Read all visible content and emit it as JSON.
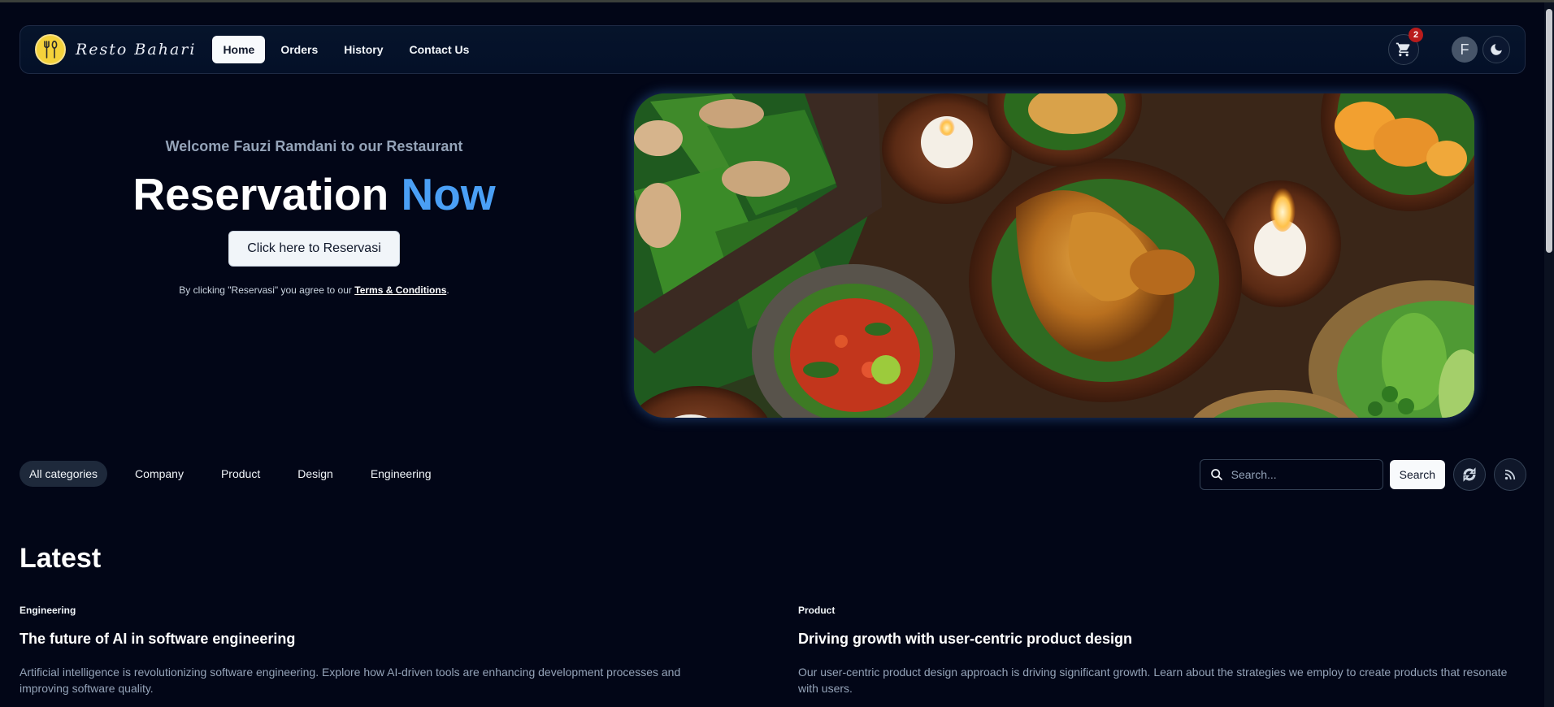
{
  "colors": {
    "background": "#020617",
    "accent": "#4a9ff5",
    "badge": "#b91c1c"
  },
  "navbar": {
    "brand": "Resto Bahari",
    "links": [
      "Home",
      "Orders",
      "History",
      "Contact Us"
    ],
    "active_link": "Home",
    "cart_count": "2",
    "avatar_initial": "F",
    "icons": [
      "logo-cutlery-icon",
      "cart-icon",
      "moon-icon"
    ]
  },
  "hero": {
    "welcome": "Welcome Fauzi Ramdani to our Restaurant",
    "title_main": "Reservation",
    "title_accent": "Now",
    "button": "Click here to Reservasi",
    "terms_prefix": "By clicking \"Reservasi\" you agree to our",
    "terms_link": "Terms & Conditions",
    "terms_suffix": "."
  },
  "categories": {
    "items": [
      "All categories",
      "Company",
      "Product",
      "Design",
      "Engineering"
    ],
    "active": "All categories"
  },
  "search": {
    "placeholder": "Search...",
    "button": "Search",
    "icons": [
      "search-icon",
      "refresh-icon",
      "rss-icon"
    ]
  },
  "latest": {
    "heading": "Latest",
    "articles": [
      {
        "tag": "Engineering",
        "title": "The future of AI in software engineering",
        "description": "Artificial intelligence is revolutionizing software engineering. Explore how AI-driven tools are enhancing development processes and improving software quality."
      },
      {
        "tag": "Product",
        "title": "Driving growth with user-centric product design",
        "description": "Our user-centric product design approach is driving significant growth. Learn about the strategies we employ to create products that resonate with users."
      }
    ]
  }
}
